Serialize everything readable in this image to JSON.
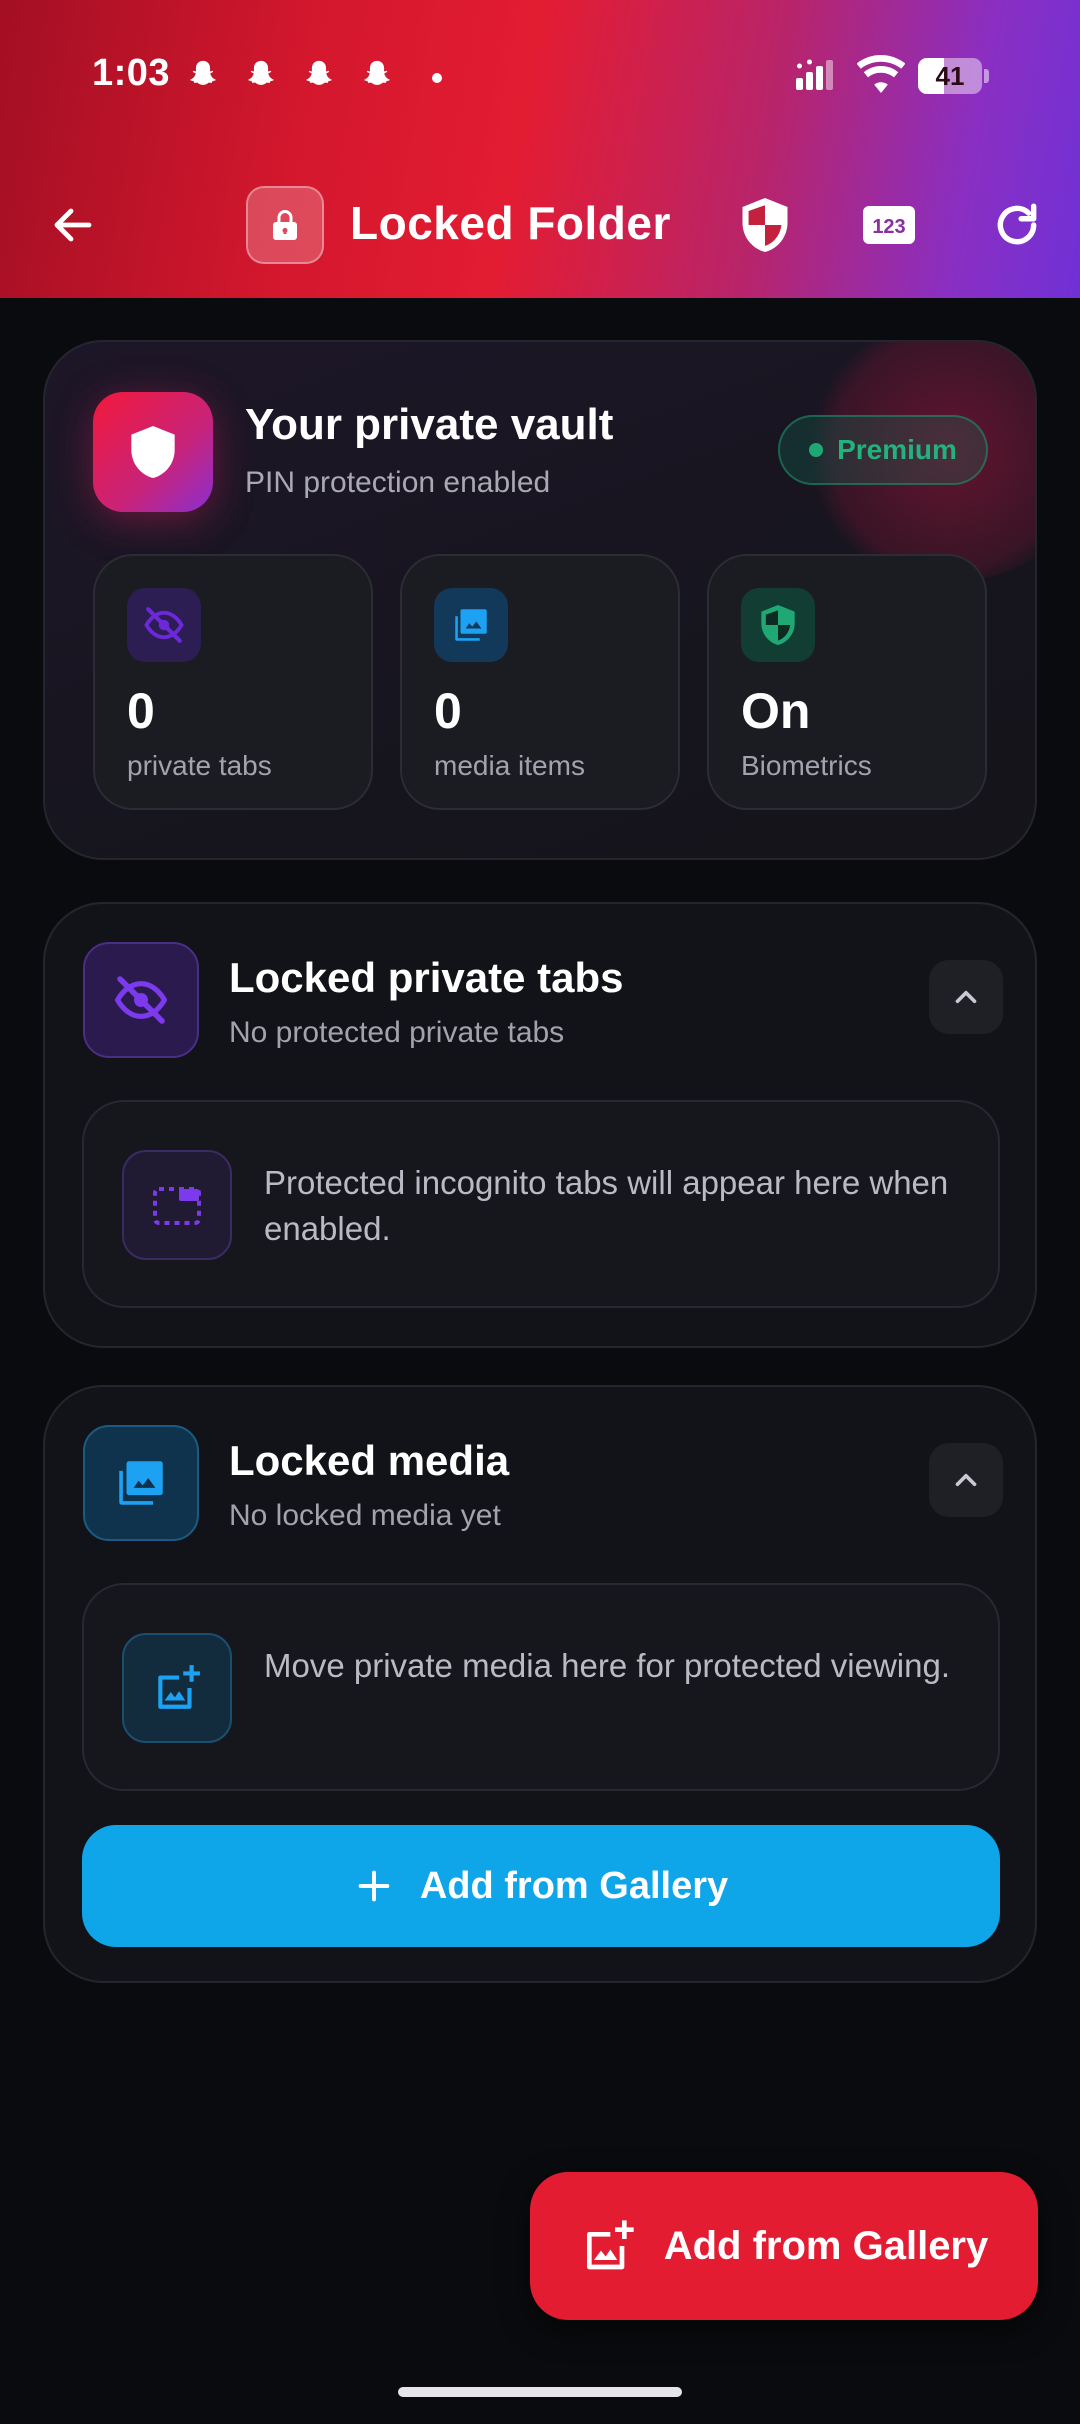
{
  "status_bar": {
    "time": "1:03",
    "battery": "41",
    "battery_level_percent": 41,
    "icons": [
      "snapchat-ghost-icon",
      "snapchat-ghost-icon",
      "snapchat-ghost-icon",
      "snapchat-ghost-icon",
      "dot-icon",
      "signal-icon",
      "wifi-icon",
      "battery-icon"
    ]
  },
  "toolbar": {
    "title": "Locked Folder",
    "icons": [
      "back-arrow-icon",
      "lock-icon",
      "shield-icon",
      "numeric-keypad-icon",
      "refresh-icon"
    ],
    "keypad_label": "123"
  },
  "vault": {
    "title": "Your private vault",
    "subtitle": "PIN protection enabled",
    "badge": "Premium",
    "stats": [
      {
        "value": "0",
        "label": "private tabs",
        "icon": "eye-off-icon"
      },
      {
        "value": "0",
        "label": "media items",
        "icon": "photo-library-icon"
      },
      {
        "value": "On",
        "label": "Biometrics",
        "icon": "shield-check-icon"
      }
    ]
  },
  "tabs_section": {
    "title": "Locked private tabs",
    "subtitle": "No protected private tabs",
    "empty_text": "Protected incognito tabs will appear here when enabled.",
    "icon": "eye-off-icon"
  },
  "media_section": {
    "title": "Locked media",
    "subtitle": "No locked media yet",
    "empty_text": "Move private media here for protected viewing.",
    "button_label": "Add from Gallery",
    "icon": "photo-library-icon"
  },
  "fab": {
    "label": "Add from Gallery",
    "icon": "add-photo-icon"
  },
  "colors": {
    "accent_red": "#e31c32",
    "accent_blue": "#0ea5e9",
    "accent_purple": "#7c3aed",
    "premium_green": "#22b27e",
    "background": "#0a0b0e"
  }
}
